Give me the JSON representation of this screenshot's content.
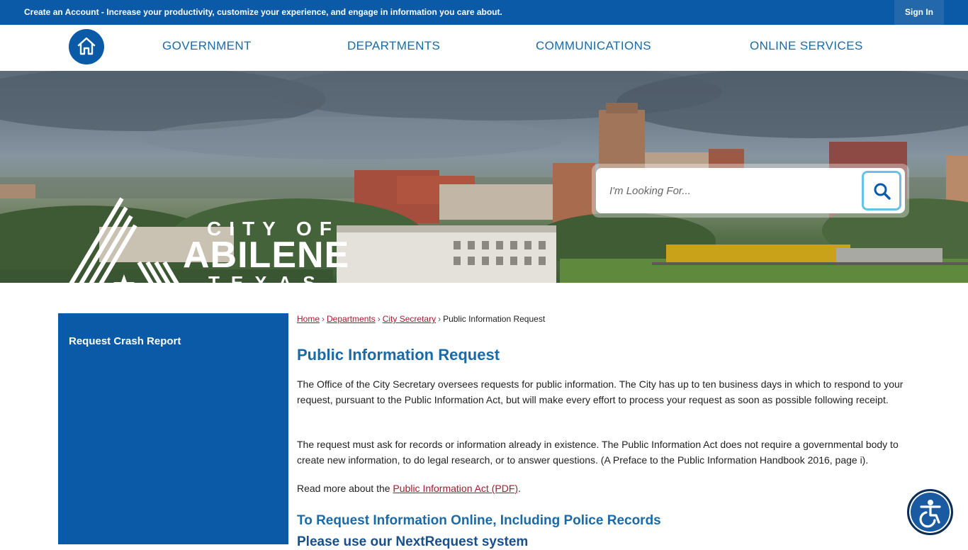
{
  "topbar": {
    "message": "Create an Account - Increase your productivity, customize your experience, and engage in information you care about.",
    "sign_in": "Sign In"
  },
  "nav": {
    "items": [
      {
        "label": "GOVERNMENT"
      },
      {
        "label": "DEPARTMENTS"
      },
      {
        "label": "COMMUNICATIONS"
      },
      {
        "label": "ONLINE SERVICES"
      }
    ]
  },
  "logo": {
    "city_of": "CITY OF",
    "name": "ABILENE",
    "state": "TEXAS"
  },
  "search": {
    "placeholder": "I'm Looking For..."
  },
  "sidebar": {
    "items": [
      {
        "label": "Request Crash Report"
      }
    ]
  },
  "breadcrumb": {
    "items": [
      "Home",
      "Departments",
      "City Secretary"
    ],
    "separator": "›",
    "current": "Public Information Request"
  },
  "content": {
    "title": "Public Information Request",
    "paragraph1": "The Office of the City Secretary oversees requests for public information. The City has up to ten business days in which to respond to your request, pursuant to the Public Information Act, but will make every effort to process your request as soon as possible following receipt.",
    "paragraph2": "The request must ask for records or information already in existence. The Public Information Act does not require a governmental body to create new information, to do legal research, or to answer questions. (A Preface to the Public Information Handbook 2016, page i).",
    "read_more_prefix": "Read more about the ",
    "read_more_link": "Public Information Act (PDF)",
    "read_more_suffix": ".",
    "heading2": "To Request Information Online, Including Police Records",
    "heading3": "Please use our NextRequest system"
  },
  "icons": {
    "home": "home-icon",
    "search": "search-icon",
    "accessibility": "accessibility-icon"
  },
  "colors": {
    "brand_blue": "#0a5aa8",
    "link_red": "#a6192e",
    "heading_blue": "#1a6aa8"
  }
}
